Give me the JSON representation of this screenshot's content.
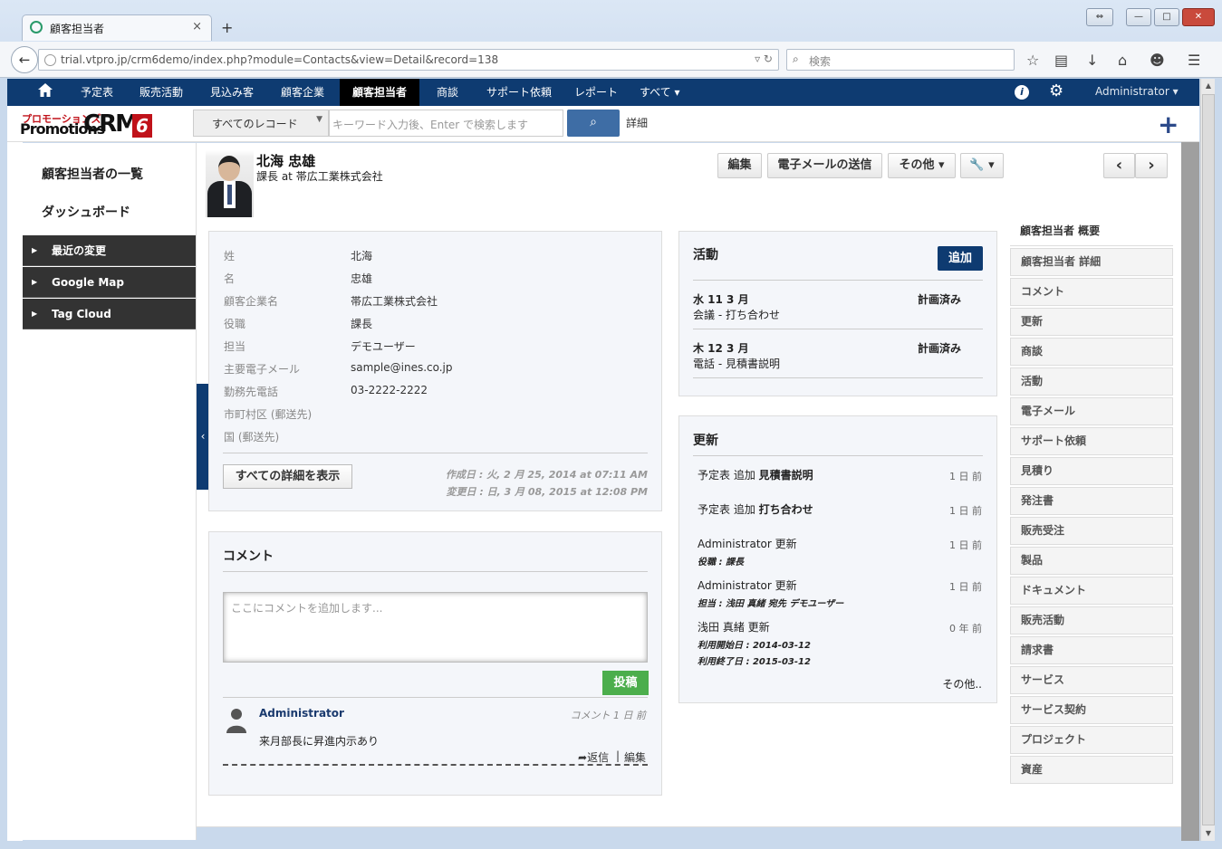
{
  "browser": {
    "tab_title": "顧客担当者",
    "tab_close": "×",
    "new_tab": "+",
    "url": "trial.vtpro.jp/crm6demo/index.php?module=Contacts&view=Detail&record=138",
    "search_placeholder": "検索",
    "win_buttons": [
      "⇔",
      "—",
      "□",
      "✕"
    ]
  },
  "nav": {
    "items": [
      "予定表",
      "販売活動",
      "見込み客",
      "顧客企業",
      "顧客担当者",
      "商談",
      "サポート依頼",
      "レポート",
      "すべて ▾"
    ],
    "active": "顧客担当者",
    "info": "i",
    "user": "Administrator ▾"
  },
  "header": {
    "logo_top": "プロモーションズ",
    "logo_left": "Promotions",
    "logo_crm": "CRM",
    "logo_num": "6",
    "record_select": "すべてのレコード",
    "search_placeholder": "キーワード入力後、Enter で検索します",
    "detail_link": "詳細",
    "plus": "+"
  },
  "sidebar": {
    "links": [
      "顧客担当者の一覧",
      "ダッシュボード"
    ],
    "widgets": [
      "最近の変更",
      "Google Map",
      "Tag Cloud"
    ]
  },
  "record": {
    "name": "北海 忠雄",
    "title": "課長 at 帯広工業株式会社",
    "buttons": {
      "edit": "編集",
      "email": "電子メールの送信",
      "more": "その他 ▾",
      "tools": "🔧 ▾"
    },
    "pager_prev": "‹",
    "pager_next": "›"
  },
  "summary": {
    "fields": [
      {
        "label": "姓",
        "value": "北海"
      },
      {
        "label": "名",
        "value": "忠雄"
      },
      {
        "label": "顧客企業名",
        "value": "帯広工業株式会社"
      },
      {
        "label": "役職",
        "value": "課長"
      },
      {
        "label": "担当",
        "value": "デモユーザー"
      },
      {
        "label": "主要電子メール",
        "value": "sample@ines.co.jp"
      },
      {
        "label": "勤務先電話",
        "value": "03-2222-2222"
      },
      {
        "label": "市町村区 (郵送先)",
        "value": ""
      },
      {
        "label": "国 (郵送先)",
        "value": ""
      }
    ],
    "show_all": "すべての詳細を表示",
    "created": "作成日 : 火, 2 月 25, 2014 at 07:11 AM",
    "modified": "変更日 : 日, 3 月 08, 2015 at 12:08 PM"
  },
  "comments": {
    "title": "コメント",
    "placeholder": "ここにコメントを追加します...",
    "post": "投稿",
    "author": "Administrator",
    "meta": "コメント 1 日 前",
    "text": "来月部長に昇進内示あり",
    "reply": "返信",
    "sep": "|",
    "edit": "編集"
  },
  "activity": {
    "title": "活動",
    "add": "追加",
    "items": [
      {
        "date": "水 11 3 月",
        "status": "計画済み",
        "desc": "会議 - 打ち合わせ"
      },
      {
        "date": "木 12 3 月",
        "status": "計画済み",
        "desc": "電話 - 見積書説明"
      }
    ]
  },
  "updates": {
    "title": "更新",
    "items": [
      {
        "pre": "予定表 追加 ",
        "bold": "見積書説明",
        "ago": "1 日 前"
      },
      {
        "pre": "予定表 追加 ",
        "bold": "打ち合わせ",
        "ago": "1 日 前"
      },
      {
        "pre": "Administrator 更新",
        "bold": "",
        "ago": "1 日 前",
        "sub": "役職 : 課長"
      },
      {
        "pre": "Administrator 更新",
        "bold": "",
        "ago": "1 日 前",
        "sub": "担当 : 浅田 真緒 宛先 デモユーザー"
      },
      {
        "pre": "浅田 真緒 更新",
        "bold": "",
        "ago": "0 年 前",
        "sub": "利用開始日 : 2014-03-12",
        "sub2": "利用終了日 : 2015-03-12"
      }
    ],
    "more": "その他.."
  },
  "related_tabs": [
    "顧客担当者 概要",
    "顧客担当者 詳細",
    "コメント",
    "更新",
    "商談",
    "活動",
    "電子メール",
    "サポート依頼",
    "見積り",
    "発注書",
    "販売受注",
    "製品",
    "ドキュメント",
    "販売活動",
    "請求書",
    "サービス",
    "サービス契約",
    "プロジェクト",
    "資産"
  ],
  "colors": {
    "nav_bg": "#0e3b71",
    "active_nav": "#000000",
    "post_green": "#4cae4c",
    "search_btn": "#3e6da5"
  }
}
